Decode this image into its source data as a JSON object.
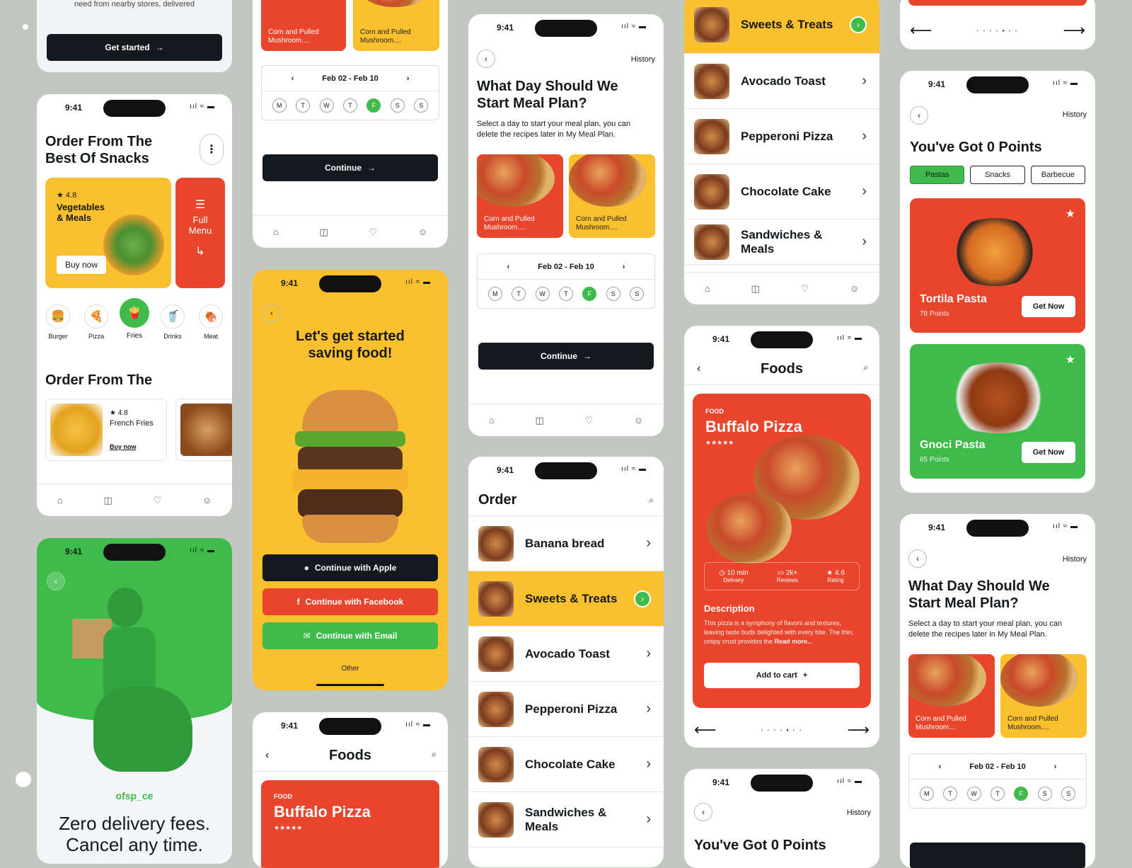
{
  "status": {
    "time": "9:41",
    "indicators": "ııl ≈ ▬"
  },
  "col1": {
    "onboard_tail": "need from nearby stores, delivered",
    "get_started": "Get started",
    "home": {
      "title": "Order From The Best Of Snacks",
      "promo": {
        "rating": "4.8",
        "name": "Vegetables & Meals",
        "buy": "Buy now"
      },
      "side": "Full Menu",
      "categories": [
        "Burger",
        "Pizza",
        "Fries",
        "Drinks",
        "Meat"
      ],
      "section": "Order From The",
      "item": {
        "rating": "4.8",
        "name": "French Fries",
        "buy": "Buy now"
      }
    },
    "delivery": {
      "brand": "ofsp_ce",
      "headline": "Zero delivery fees.",
      "headline2": "Cancel any time."
    }
  },
  "col2": {
    "tiles": [
      "Corn and Pulled Mushroom....",
      "Corn and Pulled Mushroom...."
    ],
    "week": "Feb 02 - Feb 10",
    "days": [
      "M",
      "T",
      "W",
      "T",
      "F",
      "S",
      "S"
    ],
    "continue": "Continue",
    "login": {
      "title": "Let's get started saving food!",
      "apple": "Continue with Apple",
      "facebook": "Continue with Facebook",
      "email": "Continue with Email",
      "other": "Other"
    },
    "foods": {
      "title": "Foods",
      "tag": "FOOD",
      "name": "Buffalo Pizza"
    }
  },
  "col3": {
    "history": "History",
    "title": "What Day Should We Start Meal Plan?",
    "desc": "Select a day to start your meal plan, you can delete the recipes later in My Meal Plan.",
    "tiles": [
      "Corn and Pulled Mushroom....",
      "Corn and Pulled Mushroom...."
    ],
    "week": "Feb 02 - Feb 10",
    "continue": "Continue",
    "order_title": "Order",
    "order_items": [
      "Banana bread",
      "Sweets & Treats",
      "Avocado Toast",
      "Pepperoni Pizza",
      "Chocolate Cake",
      "Sandwiches & Meals"
    ]
  },
  "col4": {
    "list": [
      "Sweets & Treats",
      "Avocado Toast",
      "Pepperoni Pizza",
      "Chocolate Cake",
      "Sandwiches & Meals"
    ],
    "foods": {
      "title": "Foods",
      "tag": "FOOD",
      "name": "Buffalo Pizza",
      "time": "10 min",
      "time_l": "Delivery",
      "reviews": "2k+",
      "reviews_l": "Reviews",
      "rating": "4.6",
      "rating_l": "Rating",
      "desc_h": "Description",
      "desc": "This pizza is a symphony of flavors and textures, leaving taste buds delighted with every bite. The thin, crispy crust provides the",
      "more": "Read more...",
      "cart": "Add to cart"
    },
    "points_title": "You've Got 0 Points",
    "history": "History"
  },
  "col5": {
    "history": "History",
    "points_title": "You've Got 0 Points",
    "chips": [
      "Pastas",
      "Snacks",
      "Barbecue"
    ],
    "rewards": [
      {
        "name": "Tortila Pasta",
        "points": "78 Points",
        "cta": "Get Now"
      },
      {
        "name": "Gnoci Pasta",
        "points": "65 Points",
        "cta": "Get Now"
      }
    ],
    "plan_title": "What Day Should We Start Meal Plan?",
    "plan_desc": "Select a day to start your meal plan, you can delete the recipes later in My Meal Plan.",
    "tiles": [
      "Corn and Pulled Mushroom....",
      "Corn and Pulled Mushroom...."
    ],
    "week": "Feb 02 - Feb 10"
  },
  "colors": {
    "red": "#e8452c",
    "yellow": "#fbc02d",
    "green": "#3ebb4b",
    "dark": "#121a1f"
  }
}
